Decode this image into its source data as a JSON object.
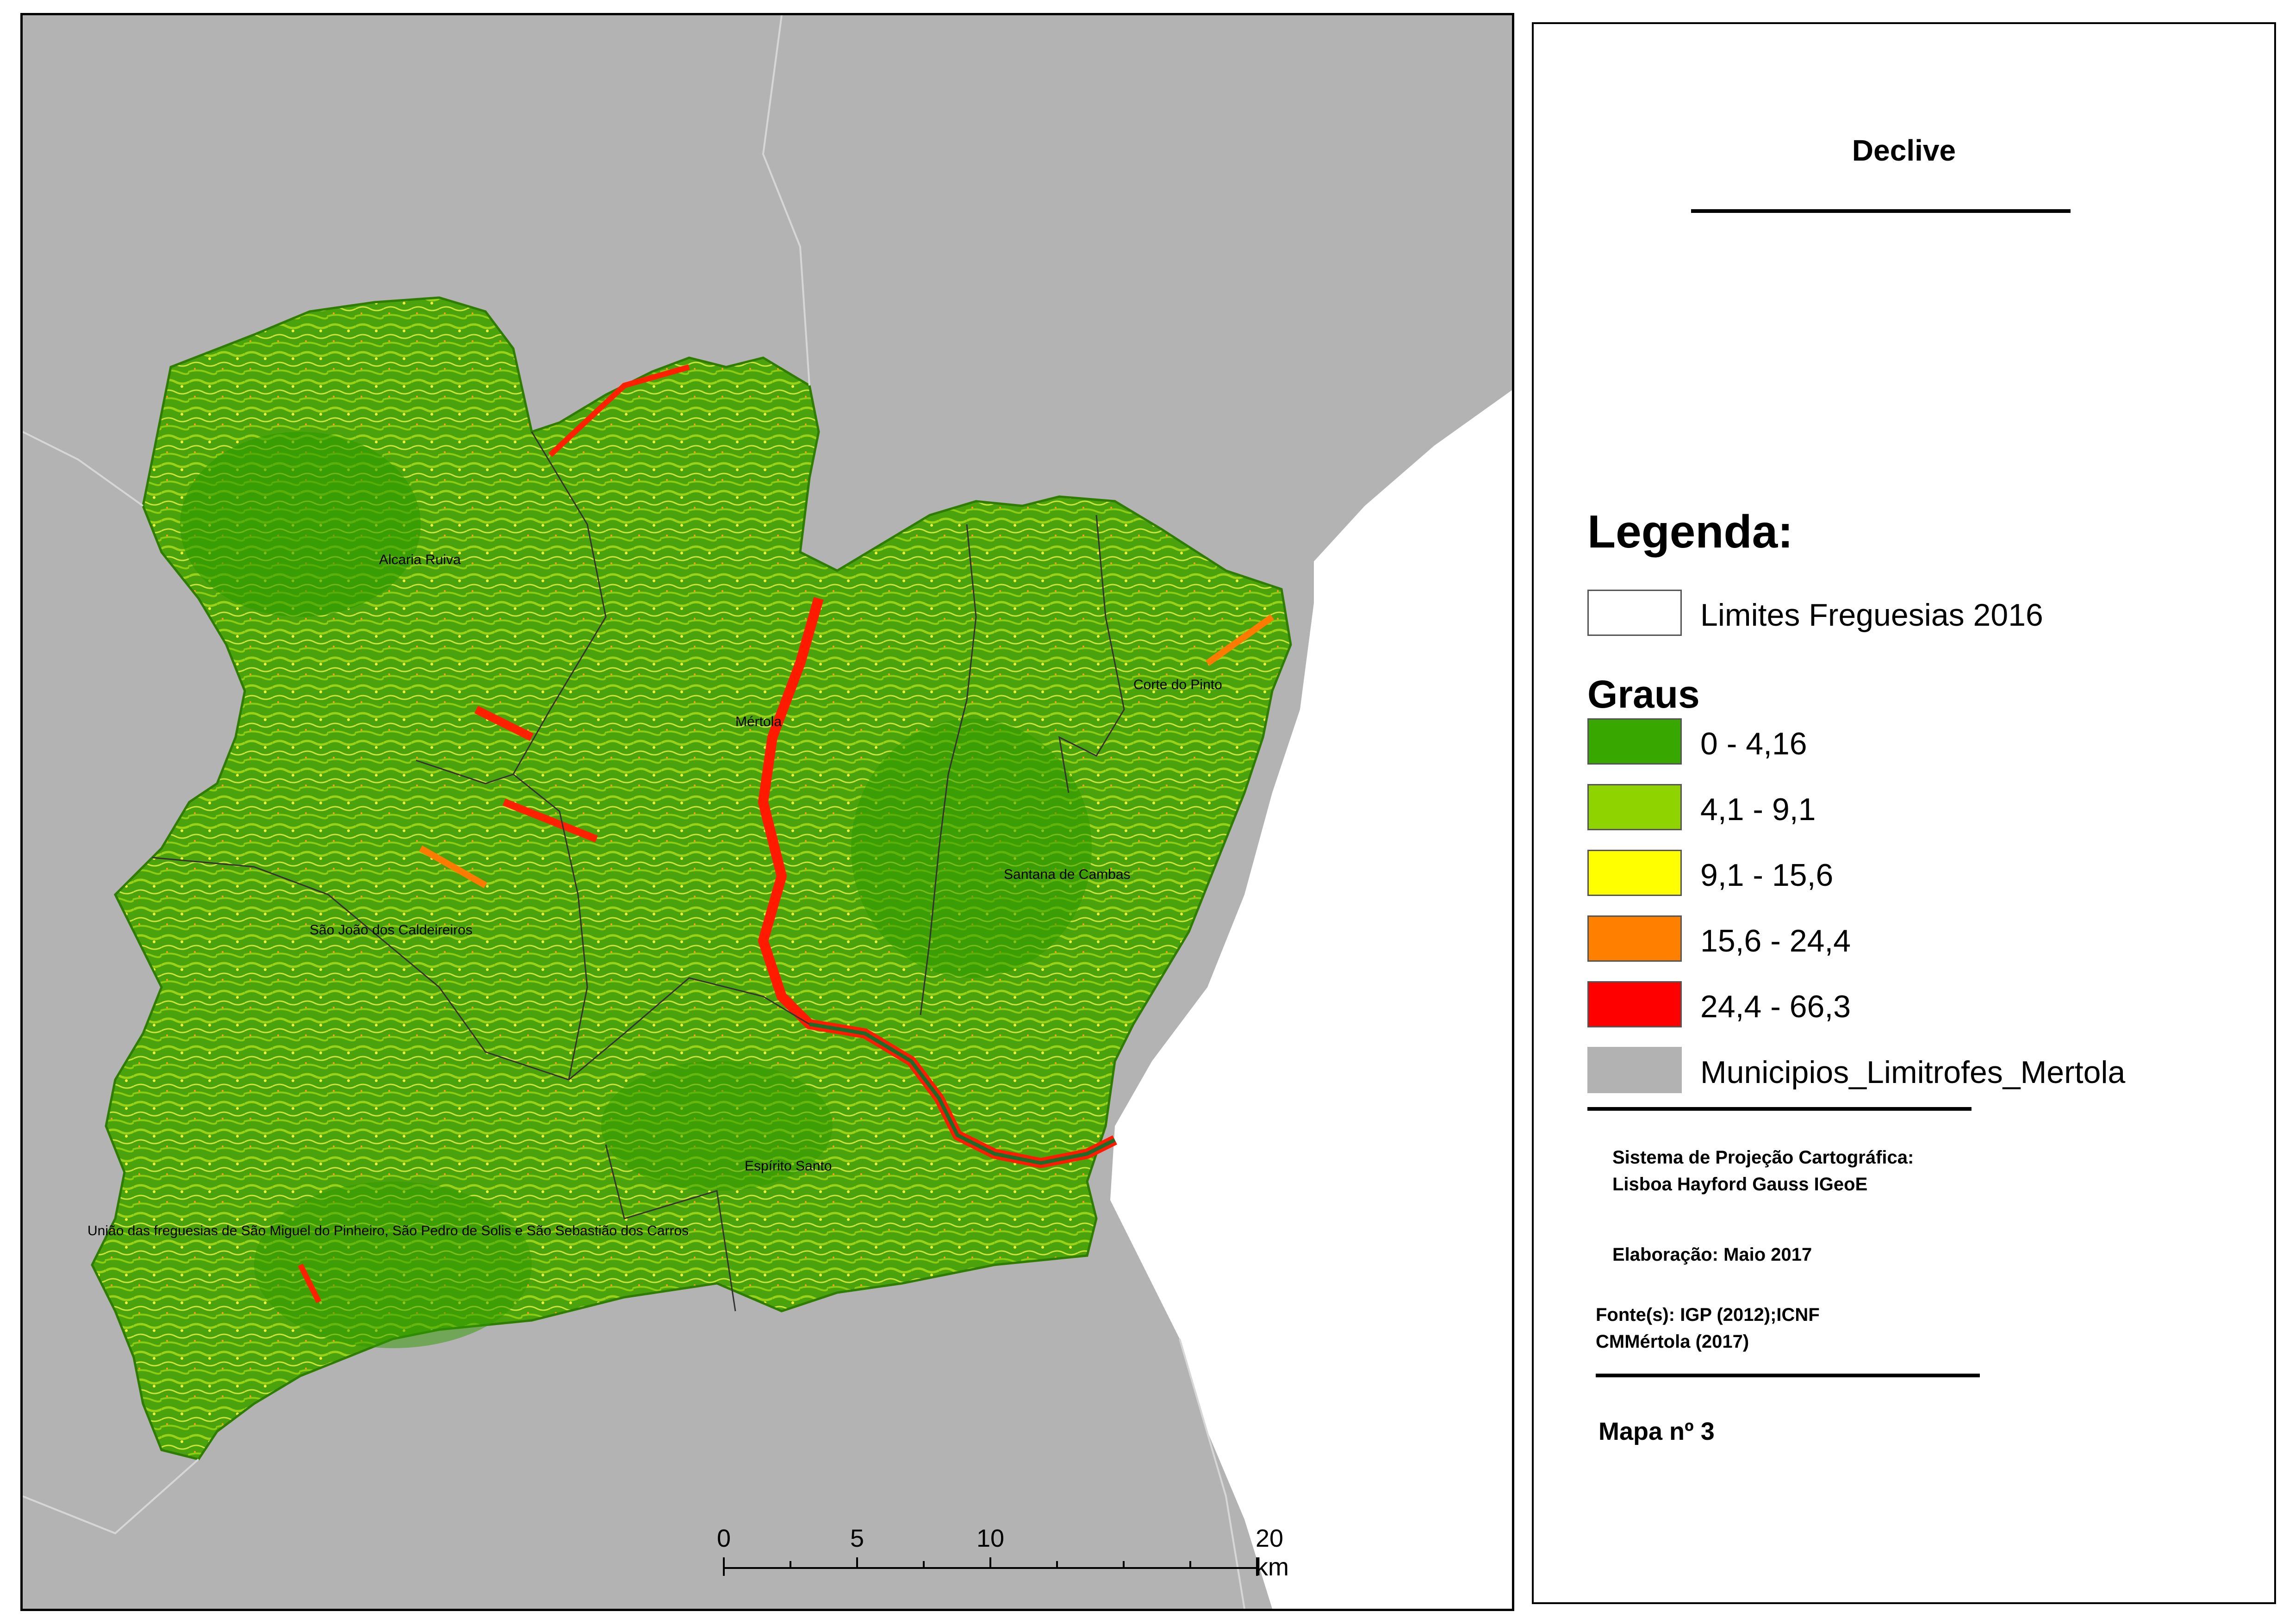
{
  "map": {
    "place_labels": [
      {
        "id": "alcaria-ruiva",
        "text": "Alcaria Ruiva"
      },
      {
        "id": "mertola",
        "text": "Mértola"
      },
      {
        "id": "corte-do-pinto",
        "text": "Corte do Pinto"
      },
      {
        "id": "santana-de-cambas",
        "text": "Santana de Cambas"
      },
      {
        "id": "sao-joao",
        "text": "São João dos Caldeireiros"
      },
      {
        "id": "espirito-santo",
        "text": "Espírito Santo"
      },
      {
        "id": "uniao",
        "text": "União das freguesias de São Miguel do Pinheiro, São Pedro de Solis e São Sebastião dos Carros"
      }
    ],
    "scalebar": {
      "tick_labels": [
        "0",
        "5",
        "10",
        "20 km"
      ]
    }
  },
  "legend": {
    "title": "Declive",
    "heading": "Legenda:",
    "boundary_label": "Limites Freguesias 2016",
    "graus_heading": "Graus",
    "classes": [
      {
        "label": "0 - 4,16",
        "color": "#38a800"
      },
      {
        "label": "4,1 - 9,1",
        "color": "#8fd400"
      },
      {
        "label": "9,1 - 15,6",
        "color": "#ffff00"
      },
      {
        "label": "15,6 - 24,4",
        "color": "#ff8000"
      },
      {
        "label": "24,4 - 66,3",
        "color": "#ff0000"
      }
    ],
    "neighbors": {
      "label": "Municipios_Limitrofes_Mertola",
      "color": "#b2b2b2"
    },
    "projection_line1": "Sistema de Projeção Cartográfica:",
    "projection_line2": "Lisboa Hayford Gauss IGeoE",
    "elaboration": "Elaboração: Maio 2017",
    "source_line1": "Fonte(s): IGP (2012);ICNF",
    "source_line2": "CMMértola (2017)",
    "map_number": "Mapa nº 3"
  }
}
